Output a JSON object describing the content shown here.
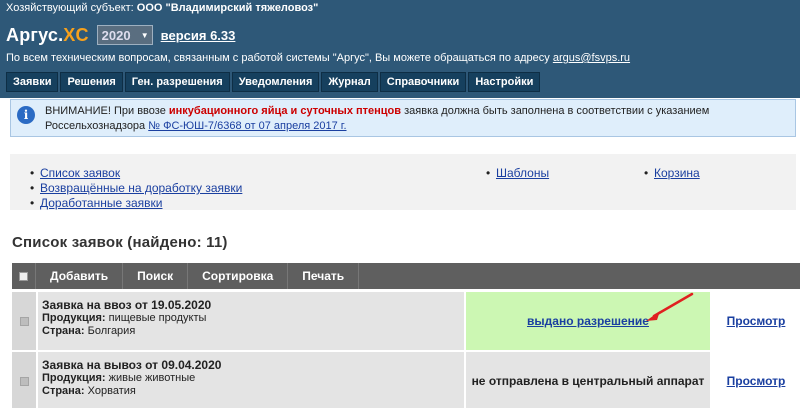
{
  "header": {
    "subject_label": "Хозяйствующий субъект:",
    "subject_value": "ООО \"Владимирский тяжеловоз\"",
    "logo_main": "Аргус.",
    "logo_accent": "XC",
    "year": "2020",
    "version": "версия 6.33",
    "support_text": "По всем техническим вопросам, связанным с работой системы \"Аргус\", Вы можете обращаться по адресу",
    "support_email": "argus@fsvps.ru"
  },
  "nav": {
    "tabs": [
      {
        "label": "Заявки"
      },
      {
        "label": "Решения"
      },
      {
        "label": "Ген. разрешения"
      },
      {
        "label": "Уведомления"
      },
      {
        "label": "Журнал"
      },
      {
        "label": "Справочники"
      },
      {
        "label": "Настройки"
      }
    ]
  },
  "notice": {
    "prefix": "ВНИМАНИЕ! При ввозе",
    "highlight": "инкубационного яйца и суточных птенцов",
    "middle": "заявка должна быть заполнена в соответствии с указанием Россельхознадзора",
    "link": "№ ФС-ЮШ-7/6368 от 07 апреля 2017 г."
  },
  "links": {
    "col1": [
      "Список заявок",
      "Возвращённые на доработку заявки",
      "Доработанные заявки"
    ],
    "col2": [
      "Шаблоны"
    ],
    "col3": [
      "Корзина"
    ]
  },
  "list": {
    "title": "Список заявок (найдено: 11)",
    "toolbar": {
      "add": "Добавить",
      "search": "Поиск",
      "sort": "Сортировка",
      "print": "Печать"
    },
    "rows": [
      {
        "title": "Заявка на ввоз от 19.05.2020",
        "product_label": "Продукция:",
        "product": "пищевые продукты",
        "country_label": "Страна:",
        "country": "Болгария",
        "status": "выдано разрешение",
        "view": "Просмотр"
      },
      {
        "title": "Заявка на вывоз от 09.04.2020",
        "product_label": "Продукция:",
        "product": "живые животные",
        "country_label": "Страна:",
        "country": "Хорватия",
        "status": "не отправлена в центральный аппарат",
        "view": "Просмотр"
      }
    ]
  },
  "colors": {
    "header_bg": "#2e5878",
    "accent": "#f7a11c",
    "status_ok_bg": "#ccf7b3",
    "annotation_arrow": "#e02020"
  }
}
